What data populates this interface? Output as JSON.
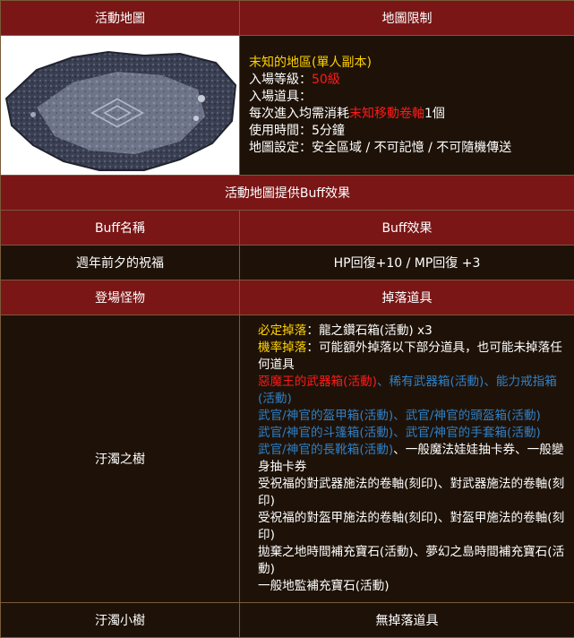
{
  "header": {
    "col1": "活動地圖",
    "col2": "地圖限制"
  },
  "map_info": {
    "name": "末知的地區(單人副本)",
    "level_label": "入場等級：",
    "level_value": "50級",
    "item_label": "入場道具：",
    "consume_prefix": "每次進入均需消耗",
    "consume_item": "末知移動卷軸",
    "consume_suffix": "1個",
    "time": "使用時間：5分鐘",
    "settings": "地圖設定：安全區域 / 不可記憶 / 不可隨機傳送"
  },
  "buff_section": {
    "title": "活動地圖提供Buff效果",
    "col1": "Buff名稱",
    "col2": "Buff效果",
    "name": "週年前夕的祝福",
    "effect": "HP回復+10 / MP回復 +3"
  },
  "monster_section": {
    "col1": "登場怪物",
    "col2": "掉落道具",
    "monster1": "汙濁之樹",
    "monster2": "汙濁小樹",
    "monster2_drop": "無掉落道具",
    "drops": {
      "guaranteed_label": "必定掉落",
      "guaranteed_item": "：龍之鑽石箱(活動) x3",
      "chance_label": "機率掉落",
      "chance_desc": "：可能額外掉落以下部分道具，也可能未掉落任何道具",
      "red_item": "惡魔王的武器箱(活動)",
      "sep1": "、",
      "blue1": "稀有武器箱(活動)",
      "sep2": "、",
      "blue2": "能力戒指箱(活動)",
      "line3": "武官/神官的盔甲箱(活動)、武官/神官的頭盔箱(活動)",
      "line4": "武官/神官的斗篷箱(活動)、武官/神官的手套箱(活動)",
      "line5_blue": "武官/神官的長靴箱(活動)",
      "line5_rest": "、一般魔法娃娃抽卡券、一般變身抽卡券",
      "line6": "受祝福的對武器施法的卷軸(刻印)、對武器施法的卷軸(刻印)",
      "line7": "受祝福的對盔甲施法的卷軸(刻印)、對盔甲施法的卷軸(刻印)",
      "line8": "拋棄之地時間補充寶石(活動)、夢幻之島時間補充寶石(活動)",
      "line9": "一般地監補充寶石(活動)"
    }
  },
  "colors": {
    "header_bg": "#7a1616",
    "cell_bg": "#1e1208",
    "border": "#7a5a3a",
    "yellow": "#ffd200",
    "red": "#ff1a1a",
    "blue": "#2e80c8"
  }
}
